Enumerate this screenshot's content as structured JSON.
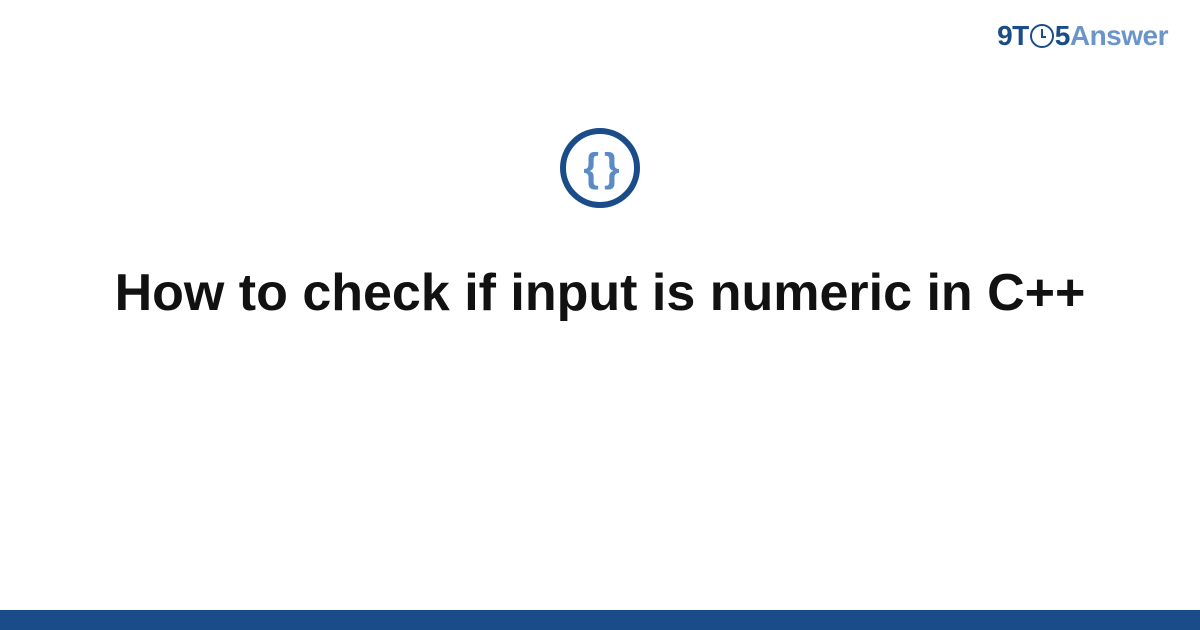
{
  "logo": {
    "part1": "9T",
    "part2": "5",
    "part3": "Answer"
  },
  "icon": {
    "braces": "{ }"
  },
  "headline": "How to check if input is numeric in C++"
}
